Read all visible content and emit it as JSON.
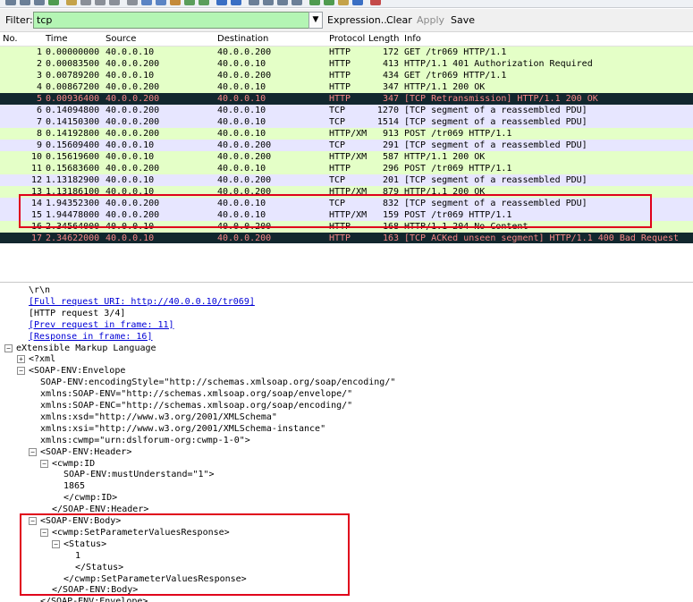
{
  "filter": {
    "label": "Filter:",
    "value": "tcp",
    "expression": "Expression...",
    "clear": "Clear",
    "apply": "Apply",
    "save": "Save"
  },
  "packet_list": {
    "columns": [
      "No.",
      "Time",
      "Source",
      "Destination",
      "Protocol",
      "Length",
      "Info"
    ],
    "rows": [
      {
        "no": "1",
        "time": "0.00000000",
        "src": "40.0.0.10",
        "dst": "40.0.0.200",
        "proto": "HTTP",
        "len": "172",
        "info": "GET /tr069 HTTP/1.1",
        "style": "http"
      },
      {
        "no": "2",
        "time": "0.00083500",
        "src": "40.0.0.200",
        "dst": "40.0.0.10",
        "proto": "HTTP",
        "len": "413",
        "info": "HTTP/1.1 401 Authorization Required",
        "style": "http"
      },
      {
        "no": "3",
        "time": "0.00789200",
        "src": "40.0.0.10",
        "dst": "40.0.0.200",
        "proto": "HTTP",
        "len": "434",
        "info": "GET /tr069 HTTP/1.1",
        "style": "http"
      },
      {
        "no": "4",
        "time": "0.00867200",
        "src": "40.0.0.200",
        "dst": "40.0.0.10",
        "proto": "HTTP",
        "len": "347",
        "info": "HTTP/1.1 200 OK",
        "style": "http"
      },
      {
        "no": "5",
        "time": "0.00936400",
        "src": "40.0.0.200",
        "dst": "40.0.0.10",
        "proto": "HTTP",
        "len": "347",
        "info": "[TCP Retransmission] HTTP/1.1 200 OK",
        "style": "bad"
      },
      {
        "no": "6",
        "time": "0.14094800",
        "src": "40.0.0.200",
        "dst": "40.0.0.10",
        "proto": "TCP",
        "len": "1270",
        "info": "[TCP segment of a reassembled PDU]",
        "style": "tcp"
      },
      {
        "no": "7",
        "time": "0.14150300",
        "src": "40.0.0.200",
        "dst": "40.0.0.10",
        "proto": "TCP",
        "len": "1514",
        "info": "[TCP segment of a reassembled PDU]",
        "style": "tcp"
      },
      {
        "no": "8",
        "time": "0.14192800",
        "src": "40.0.0.200",
        "dst": "40.0.0.10",
        "proto": "HTTP/XM",
        "len": "913",
        "info": "POST /tr069 HTTP/1.1",
        "style": "http"
      },
      {
        "no": "9",
        "time": "0.15609400",
        "src": "40.0.0.10",
        "dst": "40.0.0.200",
        "proto": "TCP",
        "len": "291",
        "info": "[TCP segment of a reassembled PDU]",
        "style": "tcp"
      },
      {
        "no": "10",
        "time": "0.15619600",
        "src": "40.0.0.10",
        "dst": "40.0.0.200",
        "proto": "HTTP/XM",
        "len": "587",
        "info": "HTTP/1.1 200 OK",
        "style": "http"
      },
      {
        "no": "11",
        "time": "0.15683600",
        "src": "40.0.0.200",
        "dst": "40.0.0.10",
        "proto": "HTTP",
        "len": "296",
        "info": "POST /tr069 HTTP/1.1",
        "style": "http"
      },
      {
        "no": "12",
        "time": "1.13182900",
        "src": "40.0.0.10",
        "dst": "40.0.0.200",
        "proto": "TCP",
        "len": "201",
        "info": "[TCP segment of a reassembled PDU]",
        "style": "tcp"
      },
      {
        "no": "13",
        "time": "1.13186100",
        "src": "40.0.0.10",
        "dst": "40.0.0.200",
        "proto": "HTTP/XM",
        "len": "879",
        "info": "HTTP/1.1 200 OK",
        "style": "http"
      },
      {
        "no": "14",
        "time": "1.94352300",
        "src": "40.0.0.200",
        "dst": "40.0.0.10",
        "proto": "TCP",
        "len": "832",
        "info": "[TCP segment of a reassembled PDU]",
        "style": "tcp"
      },
      {
        "no": "15",
        "time": "1.94478000",
        "src": "40.0.0.200",
        "dst": "40.0.0.10",
        "proto": "HTTP/XM",
        "len": "159",
        "info": "POST /tr069 HTTP/1.1",
        "style": "selected"
      },
      {
        "no": "16",
        "time": "2.34564000",
        "src": "40.0.0.10",
        "dst": "40.0.0.200",
        "proto": "HTTP",
        "len": "168",
        "info": "HTTP/1.1 204 No Content",
        "style": "http"
      },
      {
        "no": "17",
        "time": "2.34622000",
        "src": "40.0.0.10",
        "dst": "40.0.0.200",
        "proto": "HTTP",
        "len": "163",
        "info": "[TCP ACKed unseen segment] HTTP/1.1 400 Bad Request",
        "style": "bad"
      }
    ]
  },
  "detail": {
    "lines": [
      {
        "text": "\\r\\n",
        "indent": 32,
        "toggle": "",
        "link": false
      },
      {
        "text": "[Full request URI: http://40.0.0.10/tr069]",
        "indent": 32,
        "toggle": "",
        "link": true
      },
      {
        "text": "[HTTP request 3/4]",
        "indent": 32,
        "toggle": "",
        "link": false
      },
      {
        "text": "[Prev request in frame: 11]",
        "indent": 32,
        "toggle": "",
        "link": true
      },
      {
        "text": "[Response in frame: 16]",
        "indent": 32,
        "toggle": "",
        "link": true
      },
      {
        "text": "eXtensible Markup Language",
        "indent": 18,
        "toggle": "minus",
        "link": false
      },
      {
        "text": "<?xml",
        "indent": 32,
        "toggle": "plus",
        "link": false
      },
      {
        "text": "<SOAP-ENV:Envelope",
        "indent": 32,
        "toggle": "minus",
        "link": false
      },
      {
        "text": "SOAP-ENV:encodingStyle=\"http://schemas.xmlsoap.org/soap/encoding/\"",
        "indent": 45,
        "toggle": "",
        "link": false
      },
      {
        "text": "xmlns:SOAP-ENV=\"http://schemas.xmlsoap.org/soap/envelope/\"",
        "indent": 45,
        "toggle": "",
        "link": false
      },
      {
        "text": "xmlns:SOAP-ENC=\"http://schemas.xmlsoap.org/soap/encoding/\"",
        "indent": 45,
        "toggle": "",
        "link": false
      },
      {
        "text": "xmlns:xsd=\"http://www.w3.org/2001/XMLSchema\"",
        "indent": 45,
        "toggle": "",
        "link": false
      },
      {
        "text": "xmlns:xsi=\"http://www.w3.org/2001/XMLSchema-instance\"",
        "indent": 45,
        "toggle": "",
        "link": false
      },
      {
        "text": "xmlns:cwmp=\"urn:dslforum-org:cwmp-1-0\">",
        "indent": 45,
        "toggle": "",
        "link": false
      },
      {
        "text": "<SOAP-ENV:Header>",
        "indent": 45,
        "toggle": "minus",
        "link": false
      },
      {
        "text": "<cwmp:ID",
        "indent": 58,
        "toggle": "minus",
        "link": false
      },
      {
        "text": "SOAP-ENV:mustUnderstand=\"1\">",
        "indent": 71,
        "toggle": "",
        "link": false
      },
      {
        "text": "1865",
        "indent": 71,
        "toggle": "",
        "link": false
      },
      {
        "text": "</cwmp:ID>",
        "indent": 71,
        "toggle": "",
        "link": false
      },
      {
        "text": "</SOAP-ENV:Header>",
        "indent": 58,
        "toggle": "",
        "link": false
      },
      {
        "text": "<SOAP-ENV:Body>",
        "indent": 45,
        "toggle": "minus",
        "link": false
      },
      {
        "text": "<cwmp:SetParameterValuesResponse>",
        "indent": 58,
        "toggle": "minus",
        "link": false
      },
      {
        "text": "<Status>",
        "indent": 71,
        "toggle": "minus",
        "link": false
      },
      {
        "text": "1",
        "indent": 84,
        "toggle": "",
        "link": false
      },
      {
        "text": "</Status>",
        "indent": 84,
        "toggle": "",
        "link": false
      },
      {
        "text": "</cwmp:SetParameterValuesResponse>",
        "indent": 71,
        "toggle": "",
        "link": false
      },
      {
        "text": "</SOAP-ENV:Body>",
        "indent": 58,
        "toggle": "",
        "link": false
      },
      {
        "text": "</SOAP-ENV:Envelope>",
        "indent": 45,
        "toggle": "",
        "link": false
      }
    ]
  },
  "colors": {
    "http": "#e4ffc7",
    "tcp": "#e7e6ff",
    "selected": "#e7e6ff",
    "bad_bg": "#12272e",
    "bad_fg": "#f78787",
    "highlight_box": "#e0001b",
    "filter_ok": "#b4f5b4",
    "link": "#0000d6"
  }
}
